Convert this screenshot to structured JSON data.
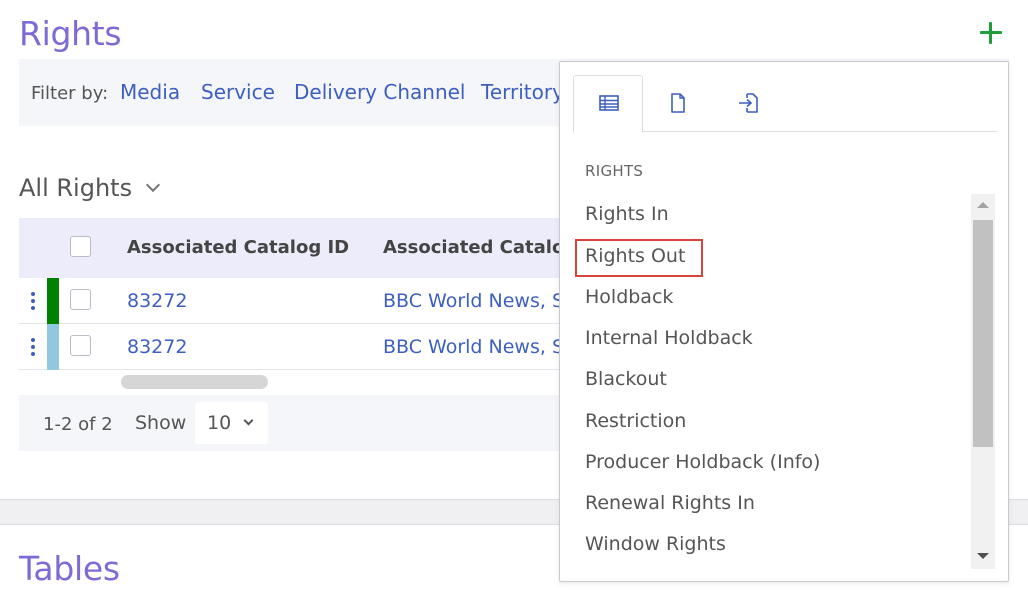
{
  "rights_section": {
    "title": "Rights"
  },
  "filter": {
    "label": "Filter by:",
    "options": [
      "Media",
      "Service",
      "Delivery Channel",
      "Territory"
    ]
  },
  "view": {
    "title": "All Rights"
  },
  "table": {
    "columns": [
      "Associated Catalog ID",
      "Associated Catalog"
    ],
    "rows": [
      {
        "catalog_id": "83272",
        "catalog_name": "BBC World News, Se",
        "status_color": "#008000"
      },
      {
        "catalog_id": "83272",
        "catalog_name": "BBC World News, Se",
        "status_color": "#8fc8e0"
      }
    ]
  },
  "pagination": {
    "range": "1-2 of 2",
    "show_label": "Show",
    "page_size": "10"
  },
  "tables_section": {
    "title": "Tables"
  },
  "popup": {
    "tabs": [
      {
        "icon": "table-icon",
        "active": true
      },
      {
        "icon": "document-icon",
        "active": false
      },
      {
        "icon": "import-icon",
        "active": false
      }
    ],
    "section_label": "RIGHTS",
    "items": [
      "Rights In",
      "Rights Out",
      "Holdback",
      "Internal Holdback",
      "Blackout",
      "Restriction",
      "Producer Holdback (Info)",
      "Renewal Rights In",
      "Window Rights"
    ],
    "highlighted_item": "Rights Out"
  },
  "colors": {
    "title_accent": "#7b6bd6",
    "link": "#3d5fbf",
    "add_button": "#1f9d3a",
    "highlight_border": "#d9443a"
  }
}
